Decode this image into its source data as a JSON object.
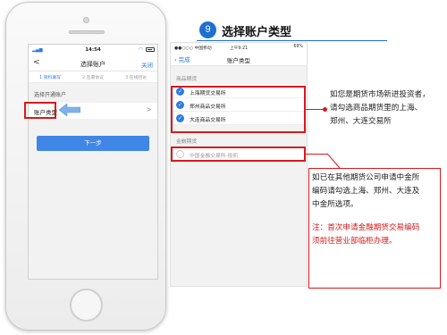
{
  "phone": {
    "status_time": "14:54",
    "nav_back": "<",
    "nav_title": "选择账户",
    "nav_close": "关闭",
    "steps": [
      "1 资料填写",
      "2 签署协议",
      "3 在线回访"
    ],
    "section_title": "选择开通账户",
    "row_label": "账户类型",
    "row_chevron": ">",
    "next_button": "下一步"
  },
  "header": {
    "step_number": "9",
    "title": "选择账户类型"
  },
  "panel": {
    "carrier": "●●○○○ 中国移动",
    "time": "上午9:21",
    "battery": "69%",
    "back_label": "完成",
    "title": "账户类型",
    "group1_header": "商品期货",
    "group1_options": [
      "上海期货交易所",
      "郑州商品交易所",
      "大连商品交易所"
    ],
    "group2_header": "金融期货",
    "group2_options": [
      "中国金融交易所-投机"
    ]
  },
  "annotations": {
    "note1_lines": [
      "如您是期货市场新进投资者，",
      "请勾选商品期货里的上海、",
      "郑州、大连交易所"
    ],
    "note2_lines": [
      "如已在其他期货公司申请中金所",
      "编码请勾选上海、郑州、大连及",
      "中金所选项。"
    ],
    "note3_lines": [
      "注：首次申请金融期货交易编码",
      "须前往营业部临柜办理。"
    ]
  },
  "colors": {
    "accent_blue": "#2d7be5",
    "title_blue": "#1e6fcf",
    "highlight_red": "#d7191c"
  }
}
